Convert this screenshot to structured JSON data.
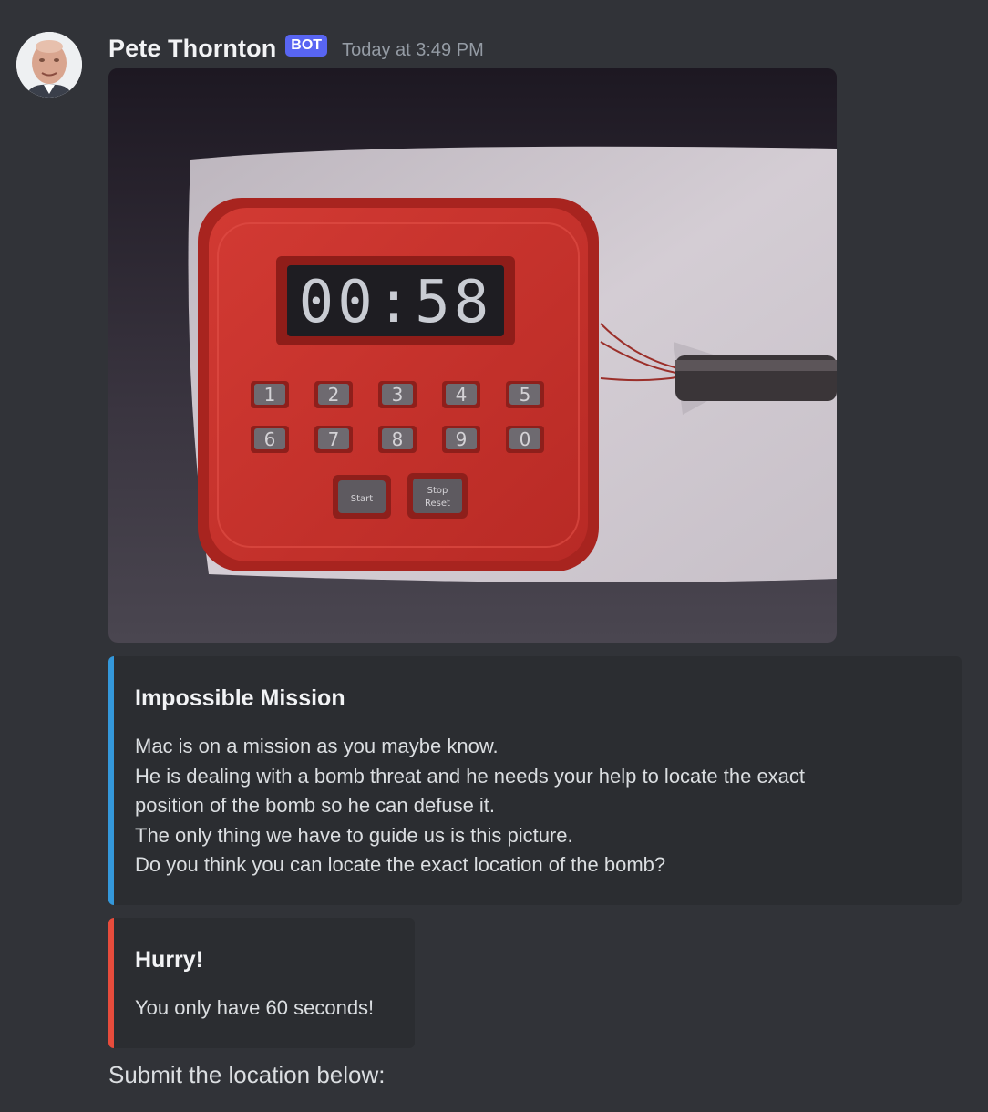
{
  "message": {
    "author": {
      "name": "Pete Thornton",
      "badge": "BOT",
      "timestamp": "Today at 3:49 PM",
      "avatar_icon": "user-avatar-photo"
    },
    "image": {
      "display_time": "00:58",
      "keypad_digits": [
        "1",
        "2",
        "3",
        "4",
        "5",
        "6",
        "7",
        "8",
        "9",
        "0"
      ],
      "start_label": "Start",
      "stop_label_line1": "Stop",
      "stop_label_line2": "Reset",
      "colors": {
        "timer_body": "#c4312c",
        "timer_border": "#a8241f",
        "putty": "#cfc8cf",
        "background": "#2b2730"
      }
    },
    "embeds": [
      {
        "accent_color": "#3498db",
        "title": "Impossible Mission",
        "lines": [
          "Mac is on a mission as you maybe know.",
          "He is dealing with a bomb threat and he needs your help to locate the exact",
          "position of the bomb so he can defuse it.",
          "The only thing we have to guide us is this picture.",
          "Do you think you can locate the exact location of the bomb?"
        ]
      },
      {
        "accent_color": "#e74c3c",
        "title": "Hurry!",
        "lines": [
          "You only have 60 seconds!"
        ]
      }
    ],
    "footer": "Submit the location below:"
  }
}
